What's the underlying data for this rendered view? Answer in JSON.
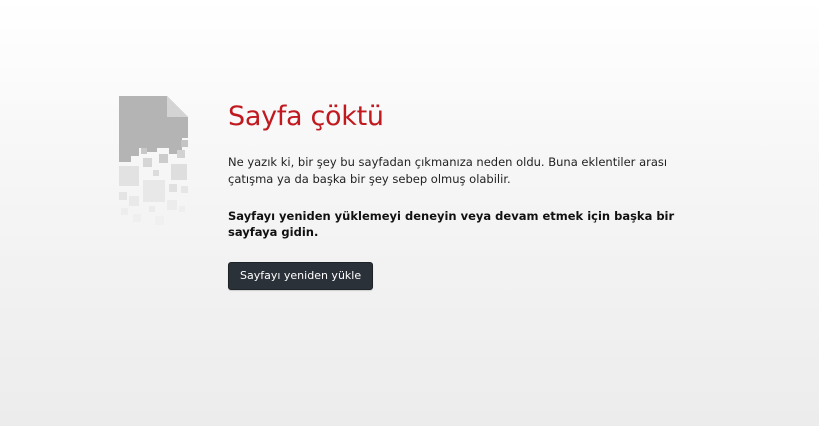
{
  "error": {
    "title": "Sayfa çöktü",
    "description": "Ne yazık ki, bir şey bu sayfadan çıkmanıza neden oldu. Buna eklentiler arası çatışma ya da başka bir şey sebep olmuş olabilir.",
    "advice": "Sayfayı yeniden yüklemeyi deneyin veya devam etmek için başka bir sayfaya gidin.",
    "reload_label": "Sayfayı yeniden yükle"
  },
  "icon": {
    "name": "crashed-page-icon",
    "color": "#bbbbbb"
  },
  "colors": {
    "title": "#c0191f",
    "button_bg": "#2b3138",
    "button_text": "#ffffff"
  }
}
